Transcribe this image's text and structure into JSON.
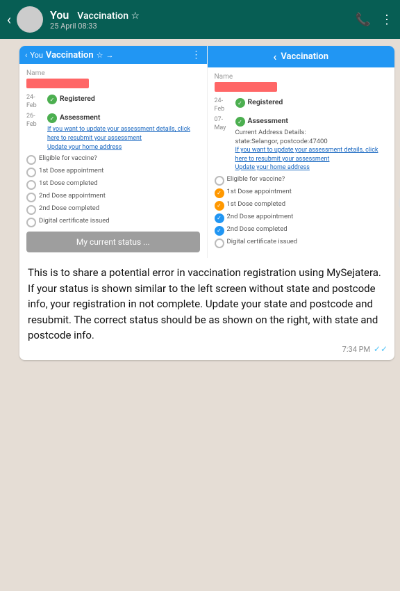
{
  "header": {
    "back_icon": "‹",
    "group_name": "You",
    "vaccination_label": "Vaccination ☆",
    "timestamp": "25 April 08:33",
    "icons": [
      "📞",
      "⋮"
    ]
  },
  "left_panel": {
    "header_you": "You",
    "header_title": "Vaccination",
    "name_label": "Name",
    "dates": [
      {
        "date": "24-\nFeb",
        "status_label": "Registered",
        "icon_type": "green"
      },
      {
        "date": "26-\nFeb",
        "status_label": "Assessment",
        "icon_type": "green",
        "sub_text": "If you want to update your assessment details, click here to resubmit your assessment\nUpdate your home address"
      }
    ],
    "checklist": [
      {
        "label": "Eligible for vaccine?",
        "icon_type": "gray"
      },
      {
        "label": "1st Dose appointment",
        "icon_type": "gray"
      },
      {
        "label": "1st Dose completed",
        "icon_type": "gray"
      },
      {
        "label": "2nd Dose appointment",
        "icon_type": "gray"
      },
      {
        "label": "2nd Dose completed",
        "icon_type": "gray"
      },
      {
        "label": "Digital certificate issued",
        "icon_type": "gray"
      }
    ],
    "current_status_btn": "My current status ..."
  },
  "right_panel": {
    "header_title": "Vaccination",
    "name_label": "Name",
    "dates": [
      {
        "date": "24-\nFeb",
        "status_label": "Registered",
        "icon_type": "green"
      },
      {
        "date": "07-\nMay",
        "status_label": "Assessment",
        "icon_type": "green",
        "sub_text": "Current Address Details:\nstate:Selangor, postcode:47400",
        "link_text": "If you want to update your assessment details, click here to resubmit your assessment\nUpdate your home address"
      }
    ],
    "checklist": [
      {
        "label": "Eligible for vaccine?",
        "icon_type": "gray"
      },
      {
        "label": "1st Dose appointment",
        "icon_type": "orange"
      },
      {
        "label": "1st Dose completed",
        "icon_type": "orange"
      },
      {
        "label": "2nd Dose appointment",
        "icon_type": "blue"
      },
      {
        "label": "2nd Dose completed",
        "icon_type": "blue"
      },
      {
        "label": "Digital certificate issued",
        "icon_type": "gray"
      }
    ]
  },
  "message": {
    "text": "This is to share a potential error in vaccination registration using MySejatera.  If your status is shown similar to the left screen without state and postcode info, your registration in not complete.  Update your state and postcode and resubmit.  The correct status should be as shown on the right, with state and postcode info.",
    "time": "7:34 PM"
  }
}
